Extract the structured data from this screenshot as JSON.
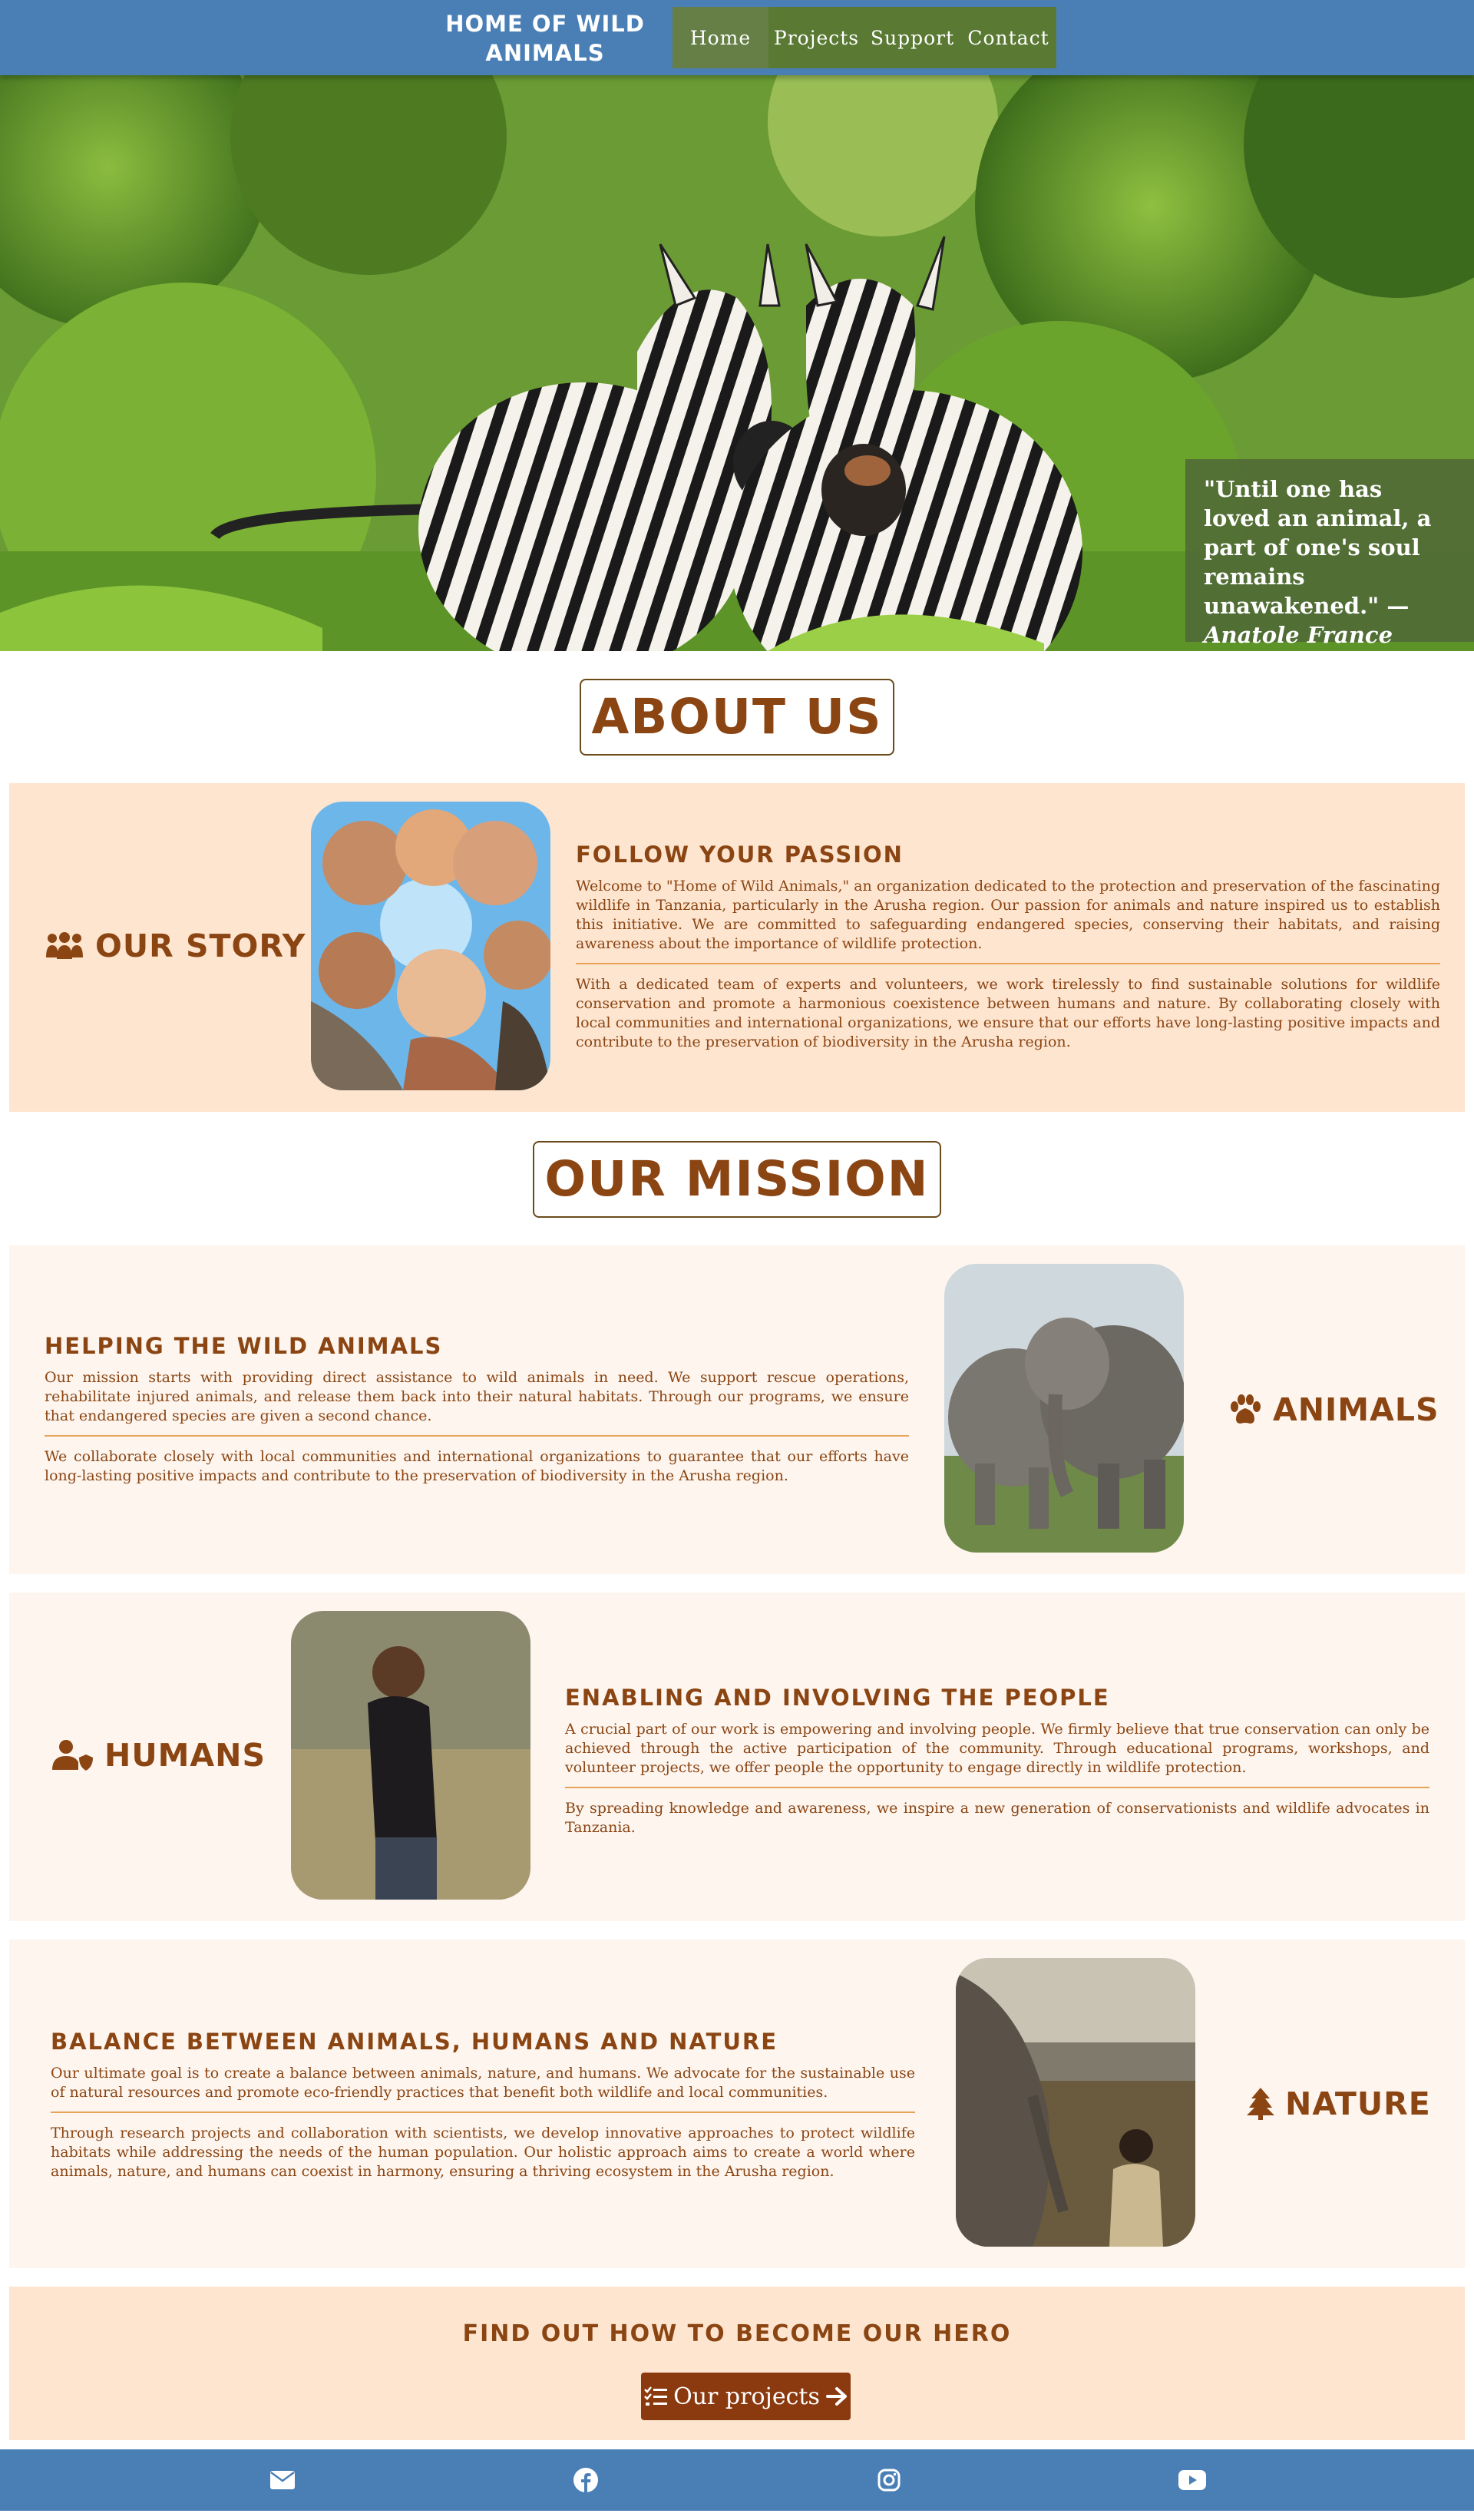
{
  "header": {
    "brand_line1": "HOME OF WILD",
    "brand_line2": "ANIMALS",
    "nav": [
      {
        "label": "Home",
        "active": true
      },
      {
        "label": "Projects",
        "active": false
      },
      {
        "label": "Support",
        "active": false
      },
      {
        "label": "Contact",
        "active": false
      }
    ]
  },
  "hero": {
    "image": "two-zebras-photo",
    "quote_text": "\"Until one has loved an animal, a part of one's soul remains unawakened.\" —",
    "quote_author": "Anatole France"
  },
  "about": {
    "title": "ABOUT US",
    "label": "OUR STORY",
    "label_icon": "people-group-icon",
    "image": "group-selfie-photo",
    "heading": "FOLLOW YOUR PASSION",
    "p1": "Welcome to \"Home of Wild Animals,\" an organization dedicated to the protection and preservation of the fascinating wildlife in Tanzania, particularly in the Arusha region. Our passion for animals and nature inspired us to establish this initiative. We are committed to safeguarding endangered species, conserving their habitats, and raising awareness about the importance of wildlife protection.",
    "p2": "With a dedicated team of experts and volunteers, we work tirelessly to find sustainable solutions for wildlife conservation and promote a harmonious coexistence between humans and nature. By collaborating closely with local communities and international organizations, we ensure that our efforts have long-lasting positive impacts and contribute to the preservation of biodiversity in the Arusha region."
  },
  "mission": {
    "title": "OUR MISSION",
    "animals": {
      "label": "ANIMALS",
      "label_icon": "paw-icon",
      "image": "elephants-photo",
      "heading": "HELPING THE WILD ANIMALS",
      "p1": "Our mission starts with providing direct assistance to wild animals in need. We support rescue operations, rehabilitate injured animals, and release them back into their natural habitats. Through our programs, we ensure that endangered species are given a second chance.",
      "p2": "We collaborate closely with local communities and international organizations to guarantee that our efforts have long-lasting positive impacts and contribute to the preservation of biodiversity in the Arusha region."
    },
    "humans": {
      "label": "HUMANS",
      "label_icon": "user-shield-icon",
      "image": "smiling-woman-photo",
      "heading": "ENABLING AND INVOLVING THE PEOPLE",
      "p1": "A crucial part of our work is empowering and involving people. We firmly believe that true conservation can only be achieved through the active participation of the community. Through educational programs, workshops, and volunteer projects, we offer people the opportunity to engage directly in wildlife protection.",
      "p2": "By spreading knowledge and awareness, we inspire a new generation of conservationists and wildlife advocates in Tanzania."
    },
    "nature": {
      "label": "NATURE",
      "label_icon": "tree-icon",
      "image": "child-and-elephant-photo",
      "heading": "BALANCE BETWEEN ANIMALS, HUMANS AND NATURE",
      "p1": "Our ultimate goal is to create a balance between animals, nature, and humans. We advocate for the sustainable use of natural resources and promote eco-friendly practices that benefit both wildlife and local communities.",
      "p2": "Through research projects and collaboration with scientists, we develop innovative approaches to protect wildlife habitats while addressing the needs of the human population. Our holistic approach aims to create a world where animals, nature, and humans can coexist in harmony, ensuring a thriving ecosystem in the Arusha region."
    }
  },
  "cta": {
    "heading": "FIND OUT HOW TO BECOME OUR HERO",
    "button_label": "Our projects",
    "button_icon_left": "list-check-icon",
    "button_icon_right": "arrow-right-icon"
  },
  "footer": {
    "icons": [
      "envelope-icon",
      "facebook-icon",
      "instagram-icon",
      "youtube-icon"
    ]
  },
  "colors": {
    "header_blue": "#4a7fb6",
    "nav_green": "#5a7a34",
    "brown": "#8b4513",
    "peach": "#fde5d0",
    "light_peach": "#fdf5ee",
    "divider_orange": "#e6a45a",
    "button_brown": "#8b3a0f"
  }
}
